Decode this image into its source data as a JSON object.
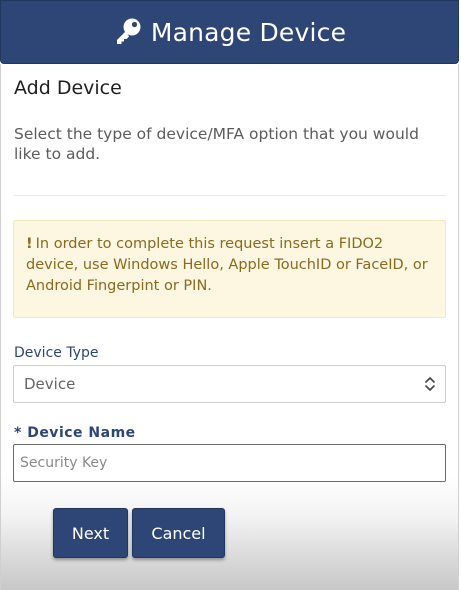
{
  "header": {
    "title": "Manage Device",
    "icon": "key-icon"
  },
  "form": {
    "section_title": "Add Device",
    "intro": "Select the type of device/MFA option that you would like to add.",
    "alert": {
      "icon": "exclamation-icon",
      "text": "In order to complete this request insert a FIDO2 device, use Windows Hello, Apple TouchID or FaceID, or Android Fingerpint or PIN."
    },
    "device_type": {
      "label": "Device Type",
      "selected": "Device"
    },
    "device_name": {
      "label": "* Device Name",
      "placeholder": "Security Key"
    },
    "buttons": {
      "next": "Next",
      "cancel": "Cancel"
    }
  },
  "colors": {
    "primary": "#2d4676",
    "alert_bg": "#fdf6e0",
    "alert_text": "#8a6a1f"
  }
}
